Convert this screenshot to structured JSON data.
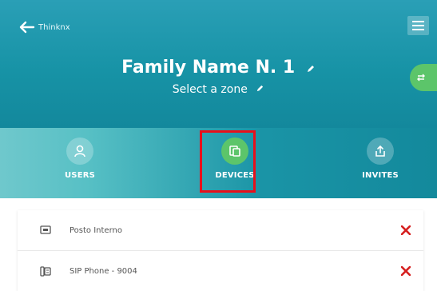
{
  "app": {
    "back_label": "Thinknx"
  },
  "header": {
    "title": "Family Name N. 1",
    "zone": "Select a zone"
  },
  "tabs": [
    {
      "label": "USERS",
      "icon": "user-icon"
    },
    {
      "label": "DEVICES",
      "icon": "devices-icon",
      "selected": true
    },
    {
      "label": "INVITES",
      "icon": "share-icon"
    }
  ],
  "devices": [
    {
      "name": "Posto Interno",
      "icon": "intercom-icon"
    },
    {
      "name": "SIP Phone - 9004",
      "icon": "phone-icon"
    }
  ],
  "colors": {
    "header": "#1793a6",
    "accent_green": "#5cc56a",
    "highlight_red": "#e8101b",
    "remove_red": "#d62020"
  }
}
